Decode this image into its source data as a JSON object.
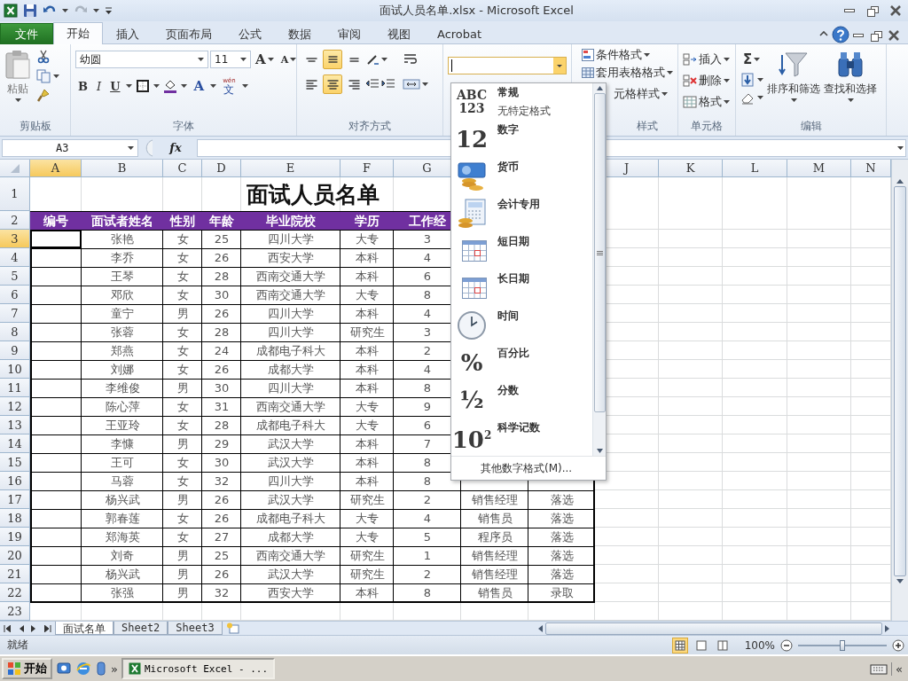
{
  "title_bar": {
    "title": "面试人员名单.xlsx - Microsoft Excel"
  },
  "ribbon_tabs": [
    {
      "label": "文件",
      "kind": "file",
      "selected": false
    },
    {
      "label": "开始",
      "kind": "tab",
      "selected": true
    },
    {
      "label": "插入",
      "kind": "tab",
      "selected": false
    },
    {
      "label": "页面布局",
      "kind": "tab",
      "selected": false
    },
    {
      "label": "公式",
      "kind": "tab",
      "selected": false
    },
    {
      "label": "数据",
      "kind": "tab",
      "selected": false
    },
    {
      "label": "审阅",
      "kind": "tab",
      "selected": false
    },
    {
      "label": "视图",
      "kind": "tab",
      "selected": false
    },
    {
      "label": "Acrobat",
      "kind": "tab",
      "selected": false
    }
  ],
  "clipboard": {
    "paste": "粘贴",
    "label": "剪贴板"
  },
  "font": {
    "name": "幼圆",
    "size": "11",
    "grow": "A",
    "shrink": "A",
    "bold": "B",
    "italic": "I",
    "underline": "U",
    "color_button": "A",
    "phonetic_top": "wén",
    "phonetic": "文",
    "label": "字体"
  },
  "alignment": {
    "vertical": [
      {
        "selected": false
      },
      {
        "selected": true
      },
      {
        "selected": false
      }
    ],
    "horizontal": [
      {
        "selected": false
      },
      {
        "selected": true
      },
      {
        "selected": false
      }
    ],
    "label": "对齐方式"
  },
  "styles": {
    "items": [
      "条件格式",
      "套用表格格式",
      "元格样式"
    ],
    "label": "样式"
  },
  "cells": {
    "items": [
      "插入",
      "删除",
      "格式"
    ],
    "label": "单元格"
  },
  "editing": {
    "sum": "Σ",
    "sort": "排序和筛选",
    "find": "查找和选择",
    "label": "编辑"
  },
  "formula_bar": {
    "name_box": "A3",
    "fx": "fx"
  },
  "sheet": {
    "columns": [
      {
        "label": "A",
        "selected": true
      },
      {
        "label": "B",
        "selected": false
      },
      {
        "label": "C",
        "selected": false
      },
      {
        "label": "D",
        "selected": false
      },
      {
        "label": "E",
        "selected": false
      },
      {
        "label": "F",
        "selected": false
      },
      {
        "label": "G",
        "selected": false
      }
    ],
    "columns_after_menu": [
      {
        "label": "J",
        "selected": false
      },
      {
        "label": "K",
        "selected": false
      },
      {
        "label": "L",
        "selected": false
      },
      {
        "label": "M",
        "selected": false
      },
      {
        "label": "N",
        "selected": false
      }
    ],
    "title_row": "1",
    "title": "面试人员名单",
    "header_row": "2",
    "headers": [
      "编号",
      "面试者姓名",
      "性别",
      "年龄",
      "毕业院校",
      "学历",
      "工作经"
    ],
    "rows": [
      {
        "n": "3",
        "selected": true,
        "cells": [
          "",
          "张艳",
          "女",
          "25",
          "四川大学",
          "大专",
          "3"
        ]
      },
      {
        "n": "4",
        "selected": false,
        "cells": [
          "",
          "李乔",
          "女",
          "26",
          "西安大学",
          "本科",
          "4"
        ]
      },
      {
        "n": "5",
        "selected": false,
        "cells": [
          "",
          "王琴",
          "女",
          "28",
          "西南交通大学",
          "本科",
          "6"
        ]
      },
      {
        "n": "6",
        "selected": false,
        "cells": [
          "",
          "邓欣",
          "女",
          "30",
          "西南交通大学",
          "大专",
          "8"
        ]
      },
      {
        "n": "7",
        "selected": false,
        "cells": [
          "",
          "童宁",
          "男",
          "26",
          "四川大学",
          "本科",
          "4"
        ]
      },
      {
        "n": "8",
        "selected": false,
        "cells": [
          "",
          "张蓉",
          "女",
          "28",
          "四川大学",
          "研究生",
          "3"
        ]
      },
      {
        "n": "9",
        "selected": false,
        "cells": [
          "",
          "郑燕",
          "女",
          "24",
          "成都电子科大",
          "本科",
          "2"
        ]
      },
      {
        "n": "10",
        "selected": false,
        "cells": [
          "",
          "刘娜",
          "女",
          "26",
          "成都大学",
          "本科",
          "4"
        ]
      },
      {
        "n": "11",
        "selected": false,
        "cells": [
          "",
          "李维俊",
          "男",
          "30",
          "四川大学",
          "本科",
          "8"
        ]
      },
      {
        "n": "12",
        "selected": false,
        "cells": [
          "",
          "陈心萍",
          "女",
          "31",
          "西南交通大学",
          "大专",
          "9"
        ]
      },
      {
        "n": "13",
        "selected": false,
        "cells": [
          "",
          "王亚玲",
          "女",
          "28",
          "成都电子科大",
          "大专",
          "6"
        ]
      },
      {
        "n": "14",
        "selected": false,
        "cells": [
          "",
          "李慷",
          "男",
          "29",
          "武汉大学",
          "本科",
          "7"
        ]
      },
      {
        "n": "15",
        "selected": false,
        "cells": [
          "",
          "王可",
          "女",
          "30",
          "武汉大学",
          "本科",
          "8"
        ]
      },
      {
        "n": "16",
        "selected": false,
        "cells": [
          "",
          "马蓉",
          "女",
          "32",
          "四川大学",
          "本科",
          "8"
        ]
      },
      {
        "n": "17",
        "selected": false,
        "cells": [
          "",
          "杨兴武",
          "男",
          "26",
          "武汉大学",
          "研究生",
          "2",
          "销售经理",
          "落选"
        ]
      },
      {
        "n": "18",
        "selected": false,
        "cells": [
          "",
          "郭春莲",
          "女",
          "26",
          "成都电子科大",
          "大专",
          "4",
          "销售员",
          "落选"
        ]
      },
      {
        "n": "19",
        "selected": false,
        "cells": [
          "",
          "郑海英",
          "女",
          "27",
          "成都大学",
          "大专",
          "5",
          "程序员",
          "落选"
        ]
      },
      {
        "n": "20",
        "selected": false,
        "cells": [
          "",
          "刘奇",
          "男",
          "25",
          "西南交通大学",
          "研究生",
          "1",
          "销售经理",
          "落选"
        ]
      },
      {
        "n": "21",
        "selected": false,
        "cells": [
          "",
          "杨兴武",
          "男",
          "26",
          "武汉大学",
          "研究生",
          "2",
          "销售经理",
          "落选"
        ]
      },
      {
        "n": "22",
        "selected": false,
        "cells": [
          "",
          "张强",
          "男",
          "32",
          "西安大学",
          "本科",
          "8",
          "销售员",
          "录取"
        ]
      }
    ],
    "empty_rows": [
      "23"
    ]
  },
  "number_format_menu": {
    "items": [
      {
        "kind": "general",
        "label": "常规",
        "sublabel": "无特定格式",
        "glyph": [
          "ABC",
          "123"
        ]
      },
      {
        "kind": "number",
        "label": "数字",
        "glyph": [
          "12"
        ]
      },
      {
        "kind": "currency",
        "label": "货币"
      },
      {
        "kind": "accounting",
        "label": "会计专用"
      },
      {
        "kind": "short_date",
        "label": "短日期"
      },
      {
        "kind": "long_date",
        "label": "长日期"
      },
      {
        "kind": "time",
        "label": "时间"
      },
      {
        "kind": "percent",
        "label": "百分比",
        "glyph": [
          "%"
        ]
      },
      {
        "kind": "fraction",
        "label": "分数",
        "glyph": [
          "½"
        ]
      },
      {
        "kind": "scientific",
        "label": "科学记数",
        "glyph": [
          "10$^{2}$"
        ]
      }
    ],
    "footer": "其他数字格式(M)..."
  },
  "sheet_tabs": [
    {
      "label": "面试名单",
      "selected": true
    },
    {
      "label": "Sheet2",
      "selected": false
    },
    {
      "label": "Sheet3",
      "selected": false
    }
  ],
  "status_bar": {
    "status": "就绪",
    "zoom": "100%",
    "views": [
      {
        "selected": true
      },
      {
        "selected": false
      },
      {
        "selected": false
      }
    ],
    "zoom_slider": {
      "level": 0.5
    }
  },
  "taskbar": {
    "start": "开始",
    "more": "»",
    "window": "Microsoft Excel - ...",
    "tray_toggle": "«"
  }
}
